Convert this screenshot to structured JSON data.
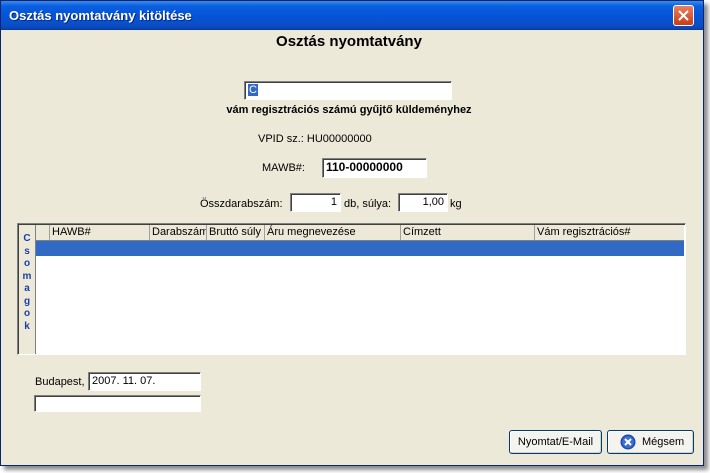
{
  "window": {
    "title": "Osztás nyomtatvány kitöltése"
  },
  "form": {
    "heading": "Osztás nyomtatvány",
    "reg_input_value": "C",
    "reg_caption": "vám regisztrációs számú gyűjtő küldeményhez",
    "vpid_label": "VPID sz.:",
    "vpid_value": "HU00000000",
    "mawb_label": "MAWB#:",
    "mawb_value": "110-00000000",
    "total_label": "Összdarabszám:",
    "total_value": "1",
    "db_suffix": "db, súlya:",
    "weight_value": "1,00",
    "kg_suffix": "kg"
  },
  "grid": {
    "side_tab_letters": [
      "C",
      "s",
      "o",
      "m",
      "a",
      "g",
      "o",
      "k"
    ],
    "columns": [
      "HAWB#",
      "Darabszám",
      "Bruttó súly",
      "Áru megnevezése",
      "Címzett",
      "Vám regisztrációs#"
    ],
    "rows": []
  },
  "footer": {
    "city_label": "Budapest,",
    "date_value": "2007. 11. 07.",
    "extra_value": ""
  },
  "buttons": {
    "print_email": "Nyomtat/E-Mail",
    "cancel": "Mégsem"
  },
  "colors": {
    "title_bar": "#0454d8",
    "selection": "#316ac5",
    "window_bg": "#ece9d8",
    "side_tab_text": "#1a3eaa"
  },
  "icons": {
    "close": "close-icon",
    "cancel": "cancel-x-icon"
  }
}
